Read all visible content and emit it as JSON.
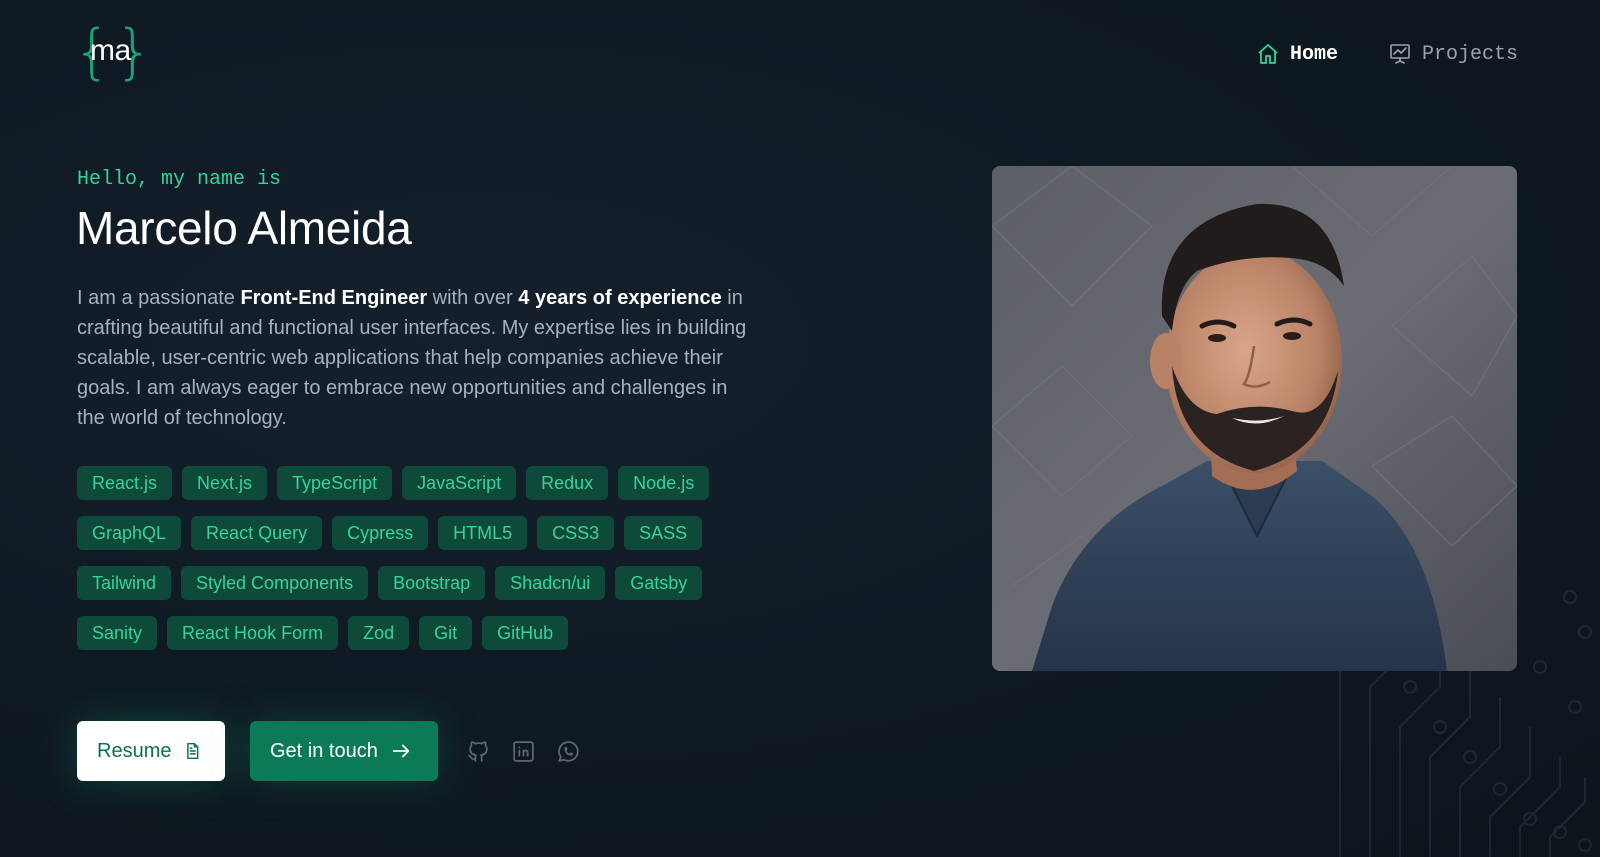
{
  "logo": {
    "text": "ma"
  },
  "nav": {
    "items": [
      {
        "label": "Home",
        "icon": "home-icon",
        "active": true
      },
      {
        "label": "Projects",
        "icon": "presentation-chart-icon",
        "active": false
      }
    ]
  },
  "hero": {
    "greeting": "Hello, my name is",
    "name": "Marcelo Almeida",
    "bio": {
      "part1": "I am a passionate ",
      "role": "Front-End Engineer",
      "part2": " with over ",
      "experience": "4 years of experience",
      "part3": " in crafting beautiful and functional user interfaces. My expertise lies in building scalable, user-centric web applications that help companies achieve their goals. I am always eager to embrace new opportunities and challenges in the world of technology."
    },
    "skills": [
      [
        "React.js",
        "Next.js",
        "TypeScript",
        "JavaScript",
        "Redux",
        "Node.js"
      ],
      [
        "GraphQL",
        "React Query",
        "Cypress",
        "HTML5",
        "CSS3",
        "SASS"
      ],
      [
        "Tailwind",
        "Styled Components",
        "Bootstrap",
        "Shadcn/ui",
        "Gatsby"
      ],
      [
        "Sanity",
        "React Hook Form",
        "Zod",
        "Git",
        "GitHub"
      ]
    ]
  },
  "actions": {
    "resume_label": "Resume",
    "resume_icon": "document-icon",
    "contact_label": "Get in touch",
    "contact_icon": "arrow-right-icon",
    "socials": [
      "github-icon",
      "linkedin-icon",
      "whatsapp-icon"
    ]
  },
  "colors": {
    "accent": "#34d399",
    "chip_bg": "#0e4a39",
    "button_primary": "#0b7a57",
    "background": "#0f1922"
  }
}
